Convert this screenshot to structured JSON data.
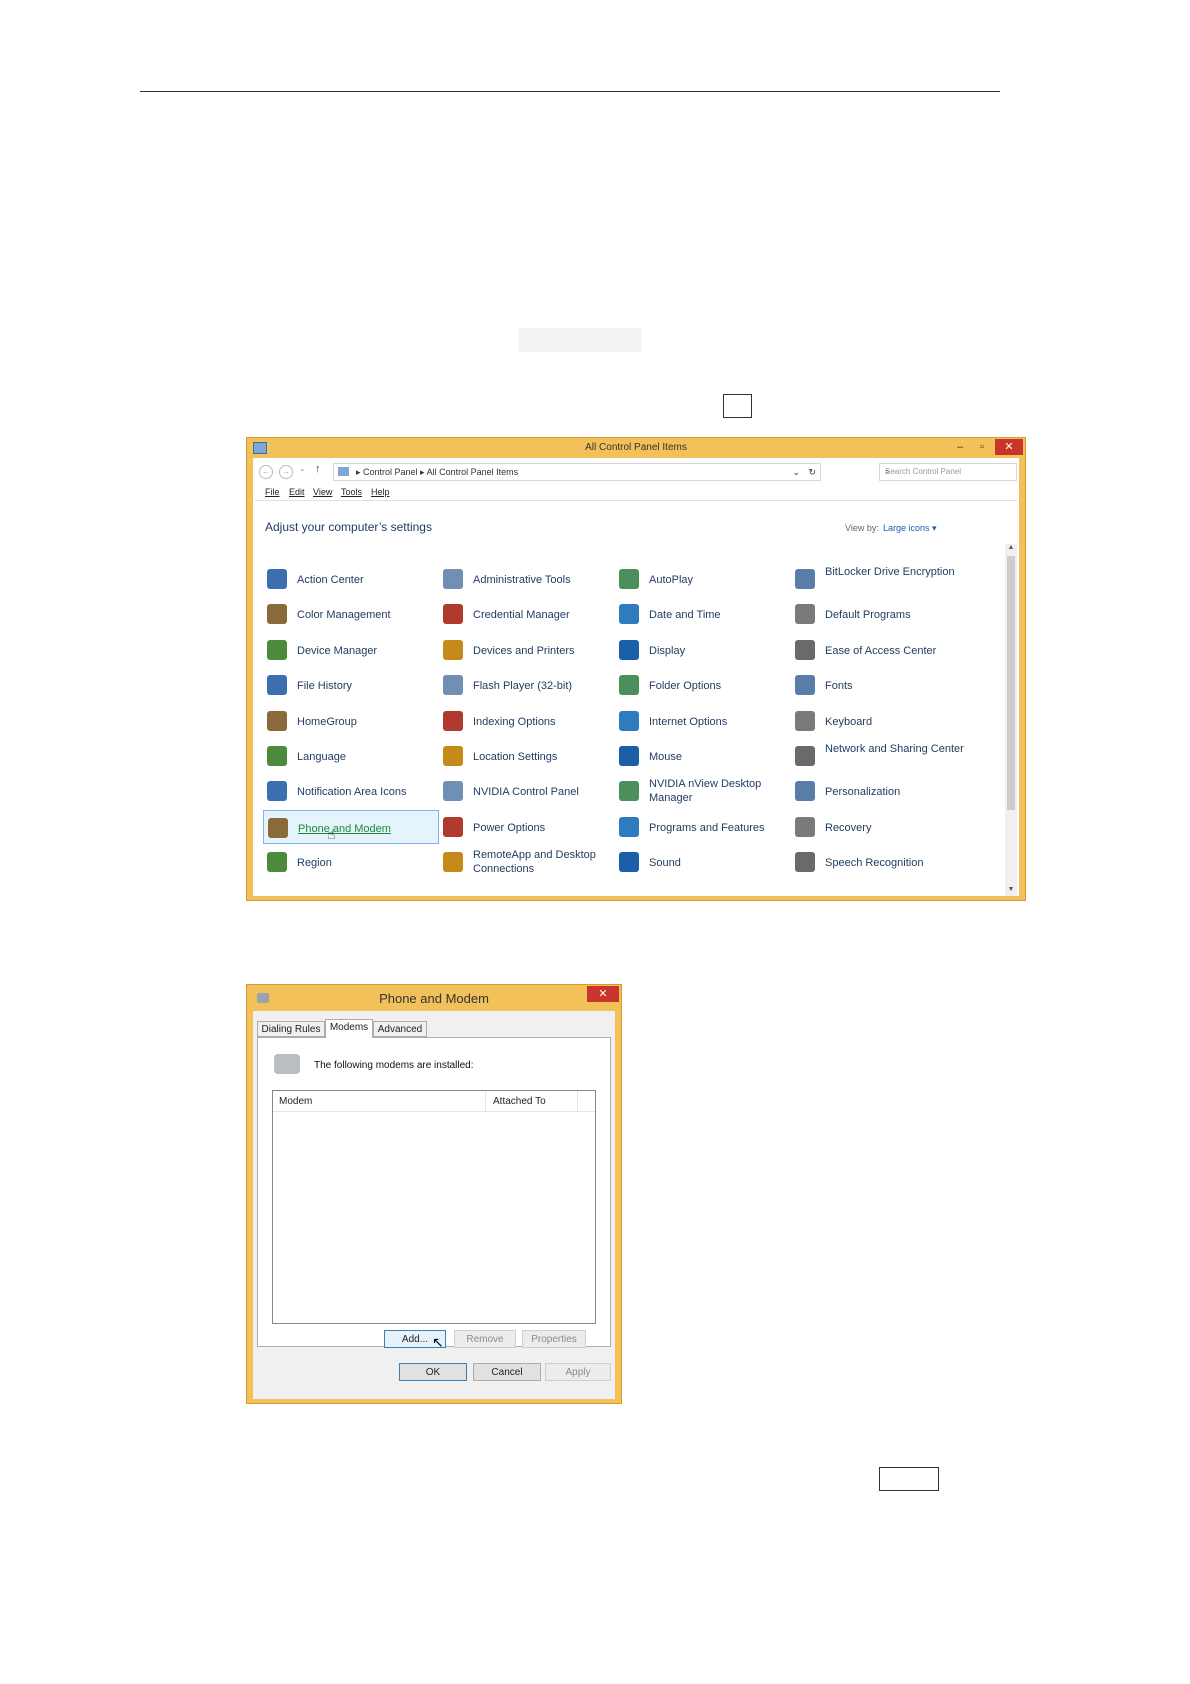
{
  "control_panel": {
    "title": "All Control Panel Items",
    "window_buttons": {
      "minimize": "–",
      "maximize": "▫",
      "close": "✕"
    },
    "address": {
      "crumbs": "▸  Control Panel  ▸  All Control Panel Items",
      "dropdown": "⌄",
      "refresh": "↻"
    },
    "search_placeholder": "Search Control Panel",
    "menu": [
      "File",
      "Edit",
      "View",
      "Tools",
      "Help"
    ],
    "heading": "Adjust your computer’s settings",
    "view_by_label": "View by:",
    "view_by_value": "Large icons ▾",
    "items": [
      [
        "Action Center",
        "Administrative Tools",
        "AutoPlay",
        "BitLocker Drive Encryption"
      ],
      [
        "Color Management",
        "Credential Manager",
        "Date and Time",
        "Default Programs"
      ],
      [
        "Device Manager",
        "Devices and Printers",
        "Display",
        "Ease of Access Center"
      ],
      [
        "File History",
        "Flash Player (32-bit)",
        "Folder Options",
        "Fonts"
      ],
      [
        "HomeGroup",
        "Indexing Options",
        "Internet Options",
        "Keyboard"
      ],
      [
        "Language",
        "Location Settings",
        "Mouse",
        "Network and Sharing Center"
      ],
      [
        "Notification Area Icons",
        "NVIDIA Control Panel",
        "NVIDIA nView Desktop Manager",
        "Personalization"
      ],
      [
        "Phone and Modem",
        "Power Options",
        "Programs and Features",
        "Recovery"
      ],
      [
        "Region",
        "RemoteApp and Desktop Connections",
        "Sound",
        "Speech Recognition"
      ]
    ],
    "selected_item": "Phone and Modem"
  },
  "phone_modem": {
    "title": "Phone and Modem",
    "close": "✕",
    "tabs": [
      "Dialing Rules",
      "Modems",
      "Advanced"
    ],
    "active_tab": "Modems",
    "info": "The following modems are installed:",
    "columns": [
      "Modem",
      "Attached To"
    ],
    "buttons": {
      "add": "Add...",
      "remove": "Remove",
      "properties": "Properties"
    },
    "footer": {
      "ok": "OK",
      "cancel": "Cancel",
      "apply": "Apply"
    }
  }
}
